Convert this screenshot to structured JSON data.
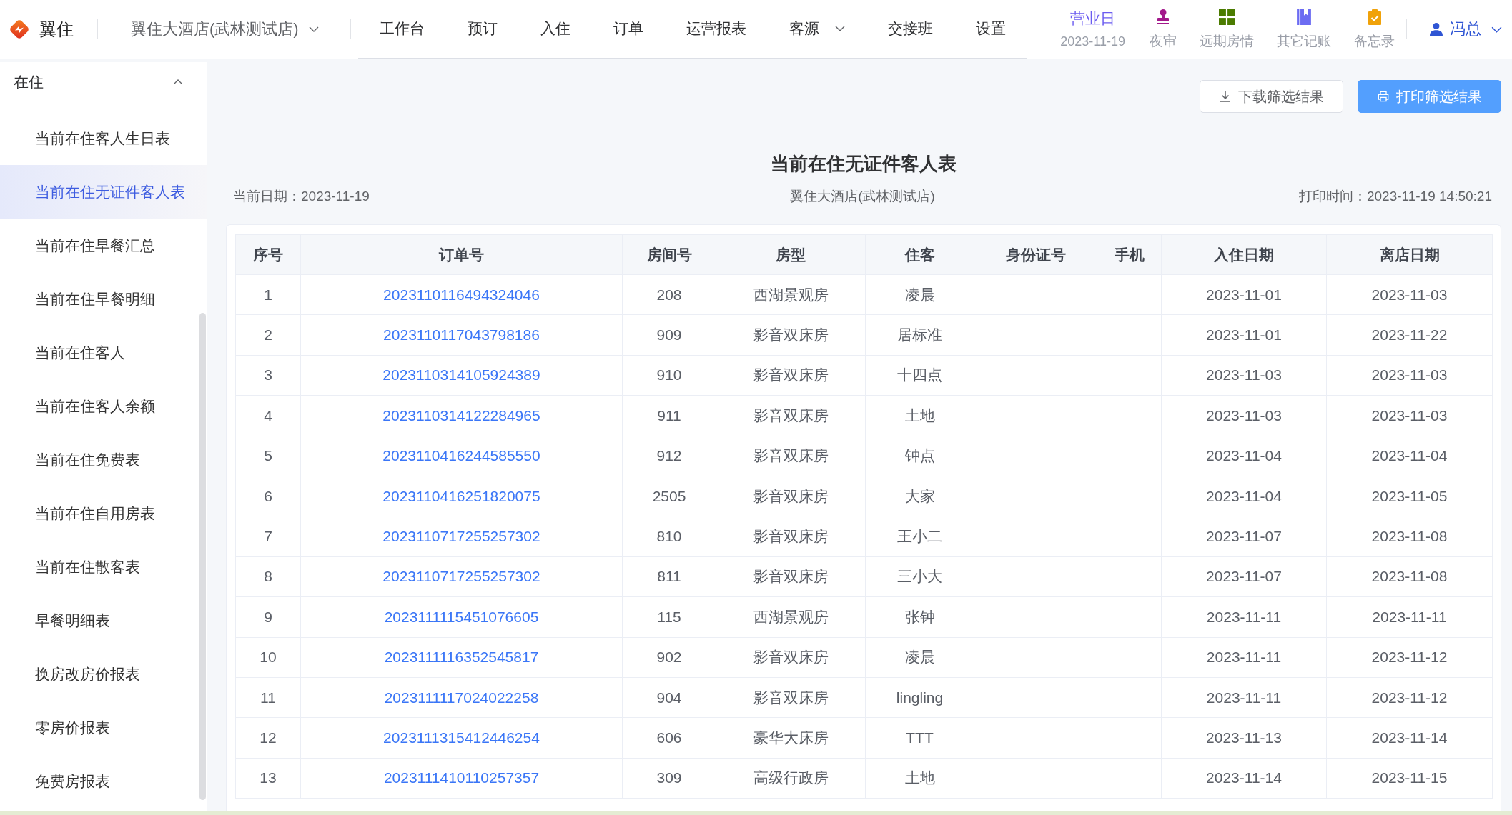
{
  "brand": {
    "name": "翼住"
  },
  "hotel_selector": {
    "value": "翼住大酒店(武林测试店)"
  },
  "nav": [
    {
      "label": "工作台",
      "selected": false,
      "dropdown": false
    },
    {
      "label": "预订",
      "selected": false,
      "dropdown": false
    },
    {
      "label": "入住",
      "selected": false,
      "dropdown": false
    },
    {
      "label": "订单",
      "selected": false,
      "dropdown": false
    },
    {
      "label": "运营报表",
      "selected": false,
      "dropdown": false
    },
    {
      "label": "客源",
      "selected": false,
      "dropdown": true
    },
    {
      "label": "交接班",
      "selected": false,
      "dropdown": false
    },
    {
      "label": "设置",
      "selected": false,
      "dropdown": false
    }
  ],
  "business_day": {
    "label": "营业日",
    "date": "2023-11-19"
  },
  "quick_actions": [
    {
      "label": "夜审",
      "kind": "stamp",
      "color": "#a3188b"
    },
    {
      "label": "远期房情",
      "kind": "grid",
      "color": "#4b7b00"
    },
    {
      "label": "其它记账",
      "kind": "book",
      "color": "#6c6cf2"
    },
    {
      "label": "备忘录",
      "kind": "clipboard",
      "color": "#f0a20a"
    }
  ],
  "user": {
    "name": "冯总"
  },
  "sidebar": {
    "group": {
      "label": "在住",
      "expanded": true
    },
    "items": [
      {
        "label": "当前在住客人生日表",
        "selected": false
      },
      {
        "label": "当前在住无证件客人表",
        "selected": true
      },
      {
        "label": "当前在住早餐汇总",
        "selected": false
      },
      {
        "label": "当前在住早餐明细",
        "selected": false
      },
      {
        "label": "当前在住客人",
        "selected": false
      },
      {
        "label": "当前在住客人余额",
        "selected": false
      },
      {
        "label": "当前在住免费表",
        "selected": false
      },
      {
        "label": "当前在住自用房表",
        "selected": false
      },
      {
        "label": "当前在住散客表",
        "selected": false
      },
      {
        "label": "早餐明细表",
        "selected": false
      },
      {
        "label": "换房改房价报表",
        "selected": false
      },
      {
        "label": "零房价报表",
        "selected": false
      },
      {
        "label": "免费房报表",
        "selected": false
      }
    ]
  },
  "toolbar": {
    "buttons": [
      {
        "label": "下载筛选结果",
        "kind": "download",
        "primary": false
      },
      {
        "label": "打印筛选结果",
        "kind": "print",
        "primary": true
      }
    ]
  },
  "report": {
    "title": "当前在住无证件客人表",
    "date": "当前日期：2023-11-19",
    "hotel": "翼住大酒店(武林测试店)",
    "print_time": "打印时间：2023-11-19 14:50:21"
  },
  "table": {
    "columns": [
      "序号",
      "订单号",
      "房间号",
      "房型",
      "住客",
      "身份证号",
      "手机",
      "入住日期",
      "离店日期"
    ],
    "rows": [
      {
        "no": "1",
        "order_no": "2023110116494324046",
        "room": "208",
        "room_type": "西湖景观房",
        "guest": "凌晨",
        "check_in": "2023-11-01",
        "check_out": "2023-11-03"
      },
      {
        "no": "2",
        "order_no": "2023110117043798186",
        "room": "909",
        "room_type": "影音双床房",
        "guest": "居标准",
        "check_in": "2023-11-01",
        "check_out": "2023-11-22"
      },
      {
        "no": "3",
        "order_no": "2023110314105924389",
        "room": "910",
        "room_type": "影音双床房",
        "guest": "十四点",
        "check_in": "2023-11-03",
        "check_out": "2023-11-03"
      },
      {
        "no": "4",
        "order_no": "2023110314122284965",
        "room": "911",
        "room_type": "影音双床房",
        "guest": "土地",
        "check_in": "2023-11-03",
        "check_out": "2023-11-03"
      },
      {
        "no": "5",
        "order_no": "2023110416244585550",
        "room": "912",
        "room_type": "影音双床房",
        "guest": "钟点",
        "check_in": "2023-11-04",
        "check_out": "2023-11-04"
      },
      {
        "no": "6",
        "order_no": "2023110416251820075",
        "room": "2505",
        "room_type": "影音双床房",
        "guest": "大家",
        "check_in": "2023-11-04",
        "check_out": "2023-11-05"
      },
      {
        "no": "7",
        "order_no": "2023110717255257302",
        "room": "810",
        "room_type": "影音双床房",
        "guest": "王小二",
        "check_in": "2023-11-07",
        "check_out": "2023-11-08"
      },
      {
        "no": "8",
        "order_no": "2023110717255257302",
        "room": "811",
        "room_type": "影音双床房",
        "guest": "三小大",
        "check_in": "2023-11-07",
        "check_out": "2023-11-08"
      },
      {
        "no": "9",
        "order_no": "2023111115451076605",
        "room": "115",
        "room_type": "西湖景观房",
        "guest": "张钟",
        "check_in": "2023-11-11",
        "check_out": "2023-11-11"
      },
      {
        "no": "10",
        "order_no": "2023111116352545817",
        "room": "902",
        "room_type": "影音双床房",
        "guest": "凌晨",
        "check_in": "2023-11-11",
        "check_out": "2023-11-12"
      },
      {
        "no": "11",
        "order_no": "2023111117024022258",
        "room": "904",
        "room_type": "影音双床房",
        "guest": "lingling",
        "check_in": "2023-11-11",
        "check_out": "2023-11-12"
      },
      {
        "no": "12",
        "order_no": "2023111315412446254",
        "room": "606",
        "room_type": "豪华大床房",
        "guest": "TTT",
        "check_in": "2023-11-13",
        "check_out": "2023-11-14"
      },
      {
        "no": "13",
        "order_no": "2023111410110257357",
        "room": "309",
        "room_type": "高级行政房",
        "guest": "土地",
        "check_in": "2023-11-14",
        "check_out": "2023-11-15"
      }
    ]
  }
}
